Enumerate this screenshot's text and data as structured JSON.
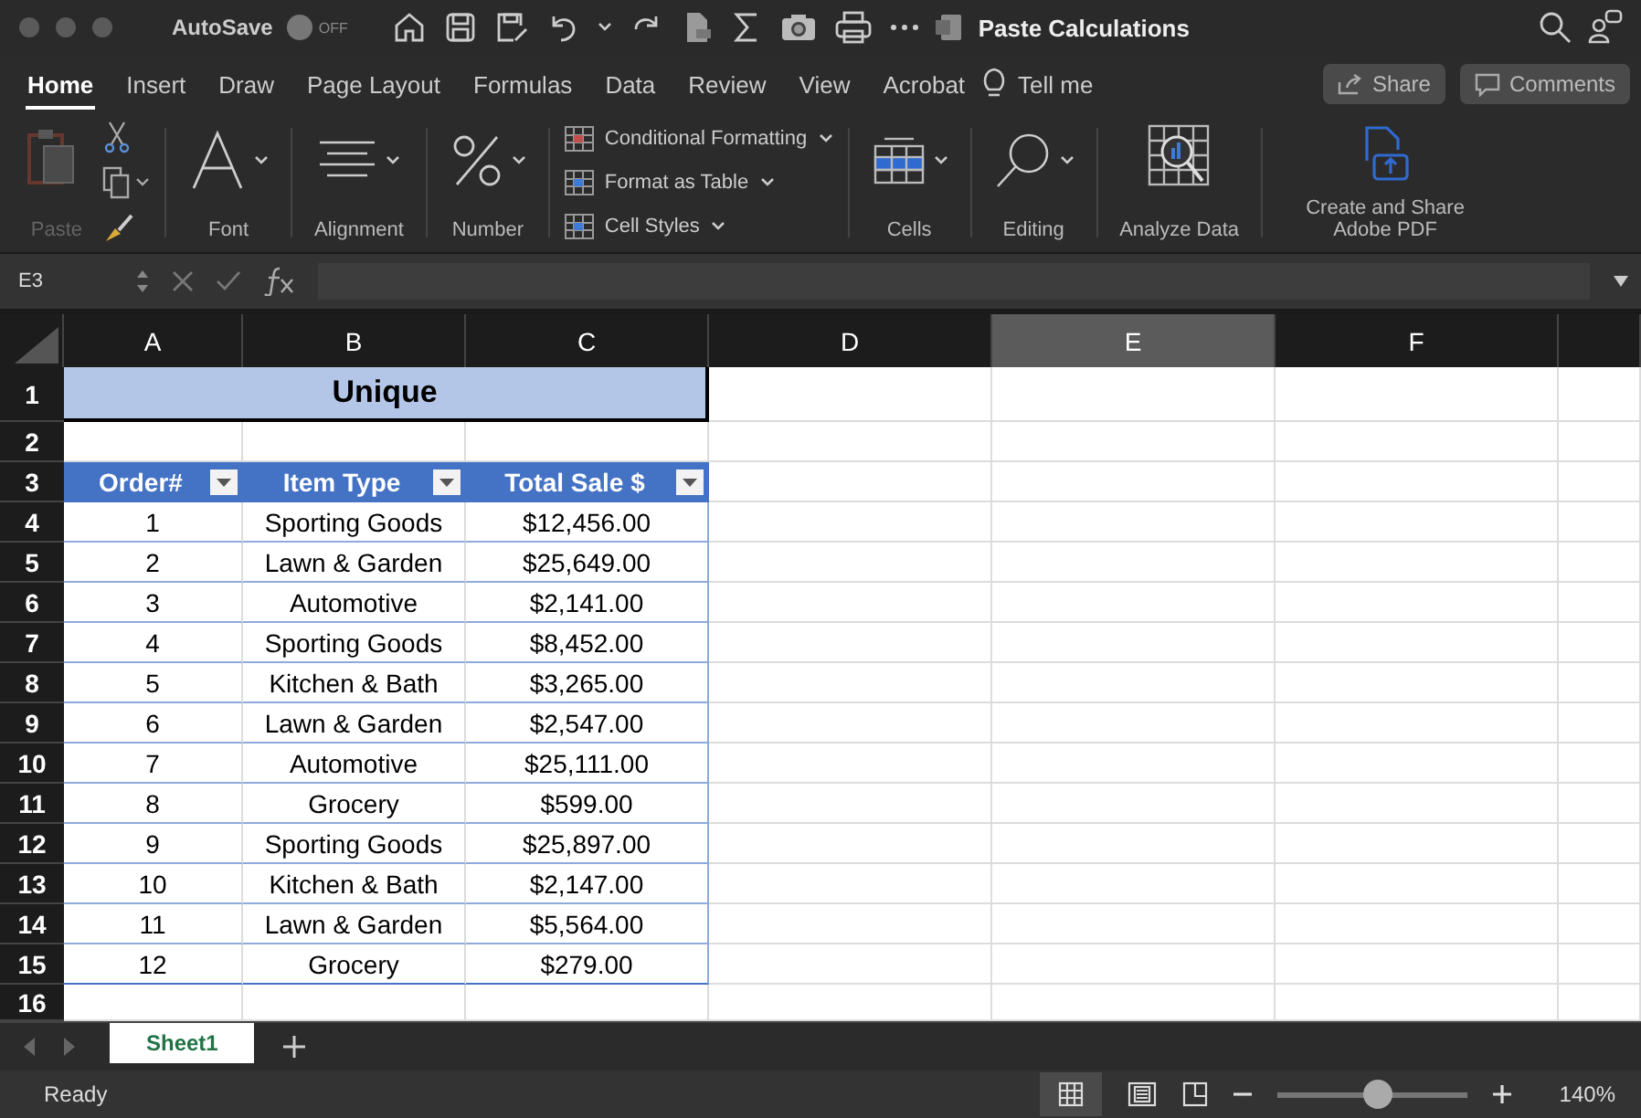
{
  "title_bar": {
    "autosave": {
      "label": "AutoSave",
      "on": false,
      "state_text": "OFF"
    },
    "title": "Paste Calculations"
  },
  "ribbon_tabs": [
    {
      "label": "Home",
      "selected": true
    },
    {
      "label": "Insert",
      "selected": false
    },
    {
      "label": "Draw",
      "selected": false
    },
    {
      "label": "Page Layout",
      "selected": false
    },
    {
      "label": "Formulas",
      "selected": false
    },
    {
      "label": "Data",
      "selected": false
    },
    {
      "label": "Review",
      "selected": false
    },
    {
      "label": "View",
      "selected": false
    },
    {
      "label": "Acrobat",
      "selected": false
    }
  ],
  "tell_me": "Tell me",
  "share_button": "Share",
  "comments_button": "Comments",
  "ribbon_groups": [
    {
      "kind": "paste",
      "label": "Paste",
      "disabled": true
    },
    {
      "kind": "font",
      "label": "Font"
    },
    {
      "kind": "alignment",
      "label": "Alignment"
    },
    {
      "kind": "number",
      "label": "Number"
    },
    {
      "kind": "styles",
      "items": [
        "Conditional Formatting",
        "Format as Table",
        "Cell Styles"
      ]
    },
    {
      "kind": "cells",
      "label": "Cells"
    },
    {
      "kind": "editing",
      "label": "Editing"
    },
    {
      "kind": "analyze",
      "label": "Analyze Data"
    },
    {
      "kind": "pdf",
      "label": "Create and Share Adobe PDF"
    }
  ],
  "formula_bar": {
    "name_box": "E3"
  },
  "sheet": {
    "columns": [
      {
        "label": "A",
        "selected": false
      },
      {
        "label": "B",
        "selected": false
      },
      {
        "label": "C",
        "selected": false
      },
      {
        "label": "D",
        "selected": false
      },
      {
        "label": "E",
        "selected": true
      },
      {
        "label": "F",
        "selected": false
      }
    ],
    "row_numbers": [
      "1",
      "2",
      "3",
      "4",
      "5",
      "6",
      "7",
      "8",
      "9",
      "10",
      "11",
      "12",
      "13",
      "14",
      "15",
      "16"
    ],
    "title": "Unique",
    "table_headers": [
      "Order#",
      "Item Type",
      "Total Sale $"
    ],
    "rows": [
      [
        "1",
        "Sporting Goods",
        "$12,456.00"
      ],
      [
        "2",
        "Lawn & Garden",
        "$25,649.00"
      ],
      [
        "3",
        "Automotive",
        "$2,141.00"
      ],
      [
        "4",
        "Sporting Goods",
        "$8,452.00"
      ],
      [
        "5",
        "Kitchen & Bath",
        "$3,265.00"
      ],
      [
        "6",
        "Lawn & Garden",
        "$2,547.00"
      ],
      [
        "7",
        "Automotive",
        "$25,111.00"
      ],
      [
        "8",
        "Grocery",
        "$599.00"
      ],
      [
        "9",
        "Sporting Goods",
        "$25,897.00"
      ],
      [
        "10",
        "Kitchen & Bath",
        "$2,147.00"
      ],
      [
        "11",
        "Lawn & Garden",
        "$5,564.00"
      ],
      [
        "12",
        "Grocery",
        "$279.00"
      ]
    ]
  },
  "sheet_tabs": [
    {
      "label": "Sheet1",
      "selected": true
    }
  ],
  "status_bar": {
    "status": "Ready",
    "zoom": {
      "level": 0.53,
      "reading": "140%"
    }
  }
}
